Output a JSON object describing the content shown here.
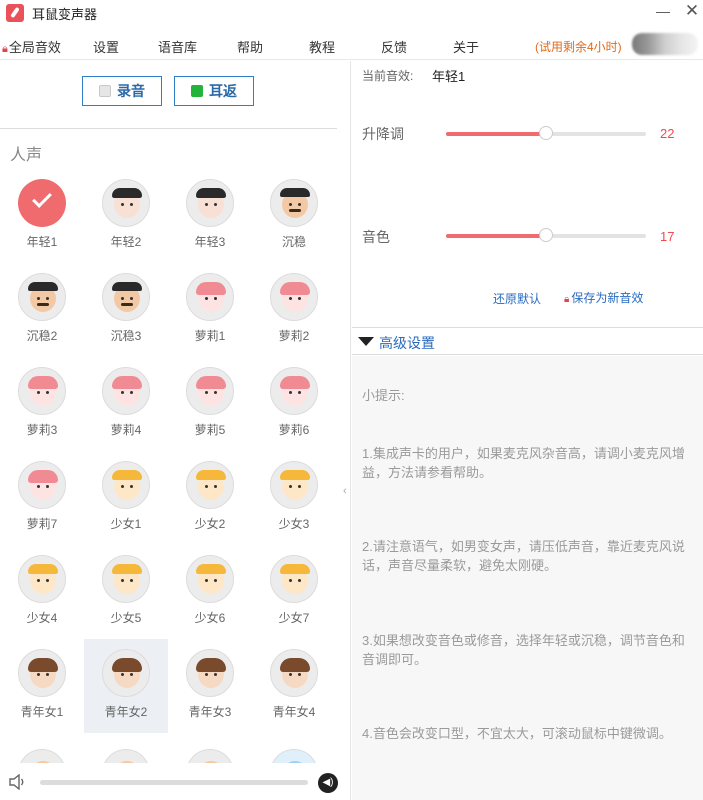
{
  "window": {
    "title": "耳鼠变声器",
    "minimize": "—",
    "close": "✕"
  },
  "menu": {
    "global_effects": "全局音效",
    "items": [
      "设置",
      "语音库",
      "帮助",
      "教程",
      "反馈",
      "关于"
    ],
    "trial": "(试用剩余4小时)"
  },
  "left": {
    "record_button": "录音",
    "monitor_button": "耳返",
    "section_title": "人声",
    "voices": [
      {
        "label": "年轻1",
        "type": "selected"
      },
      {
        "label": "年轻2",
        "type": "man"
      },
      {
        "label": "年轻3",
        "type": "man"
      },
      {
        "label": "沉稳",
        "type": "mustache"
      },
      {
        "label": "沉稳2",
        "type": "mustache"
      },
      {
        "label": "沉稳3",
        "type": "mustache"
      },
      {
        "label": "萝莉1",
        "type": "loli"
      },
      {
        "label": "萝莉2",
        "type": "loli"
      },
      {
        "label": "萝莉3",
        "type": "loli"
      },
      {
        "label": "萝莉4",
        "type": "loli"
      },
      {
        "label": "萝莉5",
        "type": "loli"
      },
      {
        "label": "萝莉6",
        "type": "loli"
      },
      {
        "label": "萝莉7",
        "type": "loli"
      },
      {
        "label": "少女1",
        "type": "girl"
      },
      {
        "label": "少女2",
        "type": "girl"
      },
      {
        "label": "少女3",
        "type": "girl"
      },
      {
        "label": "少女4",
        "type": "girl"
      },
      {
        "label": "少女5",
        "type": "girl"
      },
      {
        "label": "少女6",
        "type": "girl"
      },
      {
        "label": "少女7",
        "type": "girl"
      },
      {
        "label": "青年女1",
        "type": "woman"
      },
      {
        "label": "青年女2",
        "type": "woman"
      },
      {
        "label": "青年女3",
        "type": "woman"
      },
      {
        "label": "青年女4",
        "type": "woman"
      }
    ]
  },
  "right": {
    "current_effect_label": "当前音效:",
    "current_effect_value": "年轻1",
    "pitch_label": "升降调",
    "pitch_value": "22",
    "pitch_fraction": 0.5,
    "timbre_label": "音色",
    "timbre_value": "17",
    "timbre_fraction": 0.5,
    "reset_link": "还原默认",
    "save_link": "保存为新音效",
    "advanced_title": "高级设置",
    "tips_title": "小提示:",
    "tips": [
      "1.集成声卡的用户，如果麦克风杂音高，请调小麦克风增益，方法请参看帮助。",
      "2.请注意语气，如男变女声，请压低声音，靠近麦克风说话，声音尽量柔软，避免太刚硬。",
      "3.如果想改变音色或修音，选择年轻或沉稳，调节音色和音调即可。",
      "4.音色会改变口型，不宜太大，可滚动鼠标中键微调。"
    ]
  },
  "colors": {
    "accent": "#ef6b6e",
    "link": "#2a6bbf",
    "trial": "#e06a1c"
  }
}
